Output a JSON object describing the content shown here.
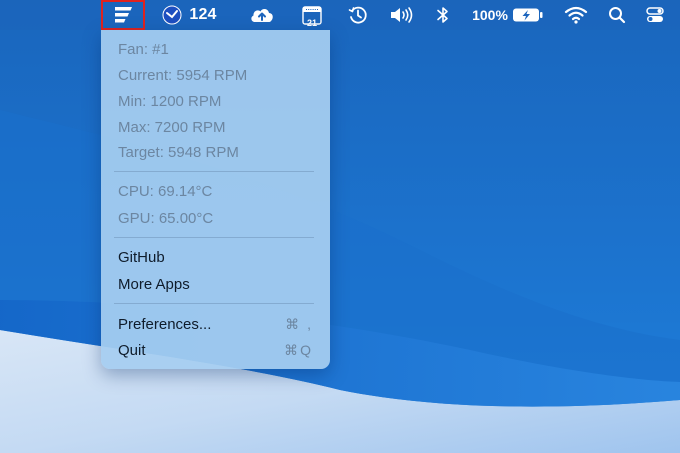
{
  "menubar": {
    "app_badge_count": "124",
    "calendar_day": "21",
    "battery_percent": "100%"
  },
  "fan_menu": {
    "info": [
      {
        "id": "fan",
        "label": "Fan: #1"
      },
      {
        "id": "current",
        "label": "Current: 5954 RPM"
      },
      {
        "id": "min",
        "label": "Min: 1200 RPM"
      },
      {
        "id": "max",
        "label": "Max: 7200 RPM"
      },
      {
        "id": "target",
        "label": "Target: 5948 RPM"
      }
    ],
    "temps": [
      {
        "id": "cpu",
        "label": "CPU: 69.14°C"
      },
      {
        "id": "gpu",
        "label": "GPU: 65.00°C"
      }
    ],
    "links": [
      {
        "id": "github",
        "label": "GitHub"
      },
      {
        "id": "more-apps",
        "label": "More Apps"
      }
    ],
    "actions": [
      {
        "id": "preferences",
        "label": "Preferences...",
        "shortcut": "⌘ ,"
      },
      {
        "id": "quit",
        "label": "Quit",
        "shortcut": "⌘Q"
      }
    ]
  },
  "icons": {
    "fan_app": "fan-menu-icon",
    "badge_app": "blue-circle-app-icon",
    "cloud": "cloud-upload-icon",
    "calendar": "calendar-icon",
    "time_machine": "time-machine-icon",
    "volume": "volume-icon",
    "bluetooth": "bluetooth-icon",
    "battery": "battery-charging-icon",
    "wifi": "wifi-icon",
    "search": "spotlight-search-icon",
    "control_center": "control-center-icon"
  },
  "colors": {
    "highlight_border": "#e0231e",
    "menu_background": "#a6cdf0",
    "disabled_text": "#6c86a1",
    "enabled_text": "#0f1c2b"
  }
}
